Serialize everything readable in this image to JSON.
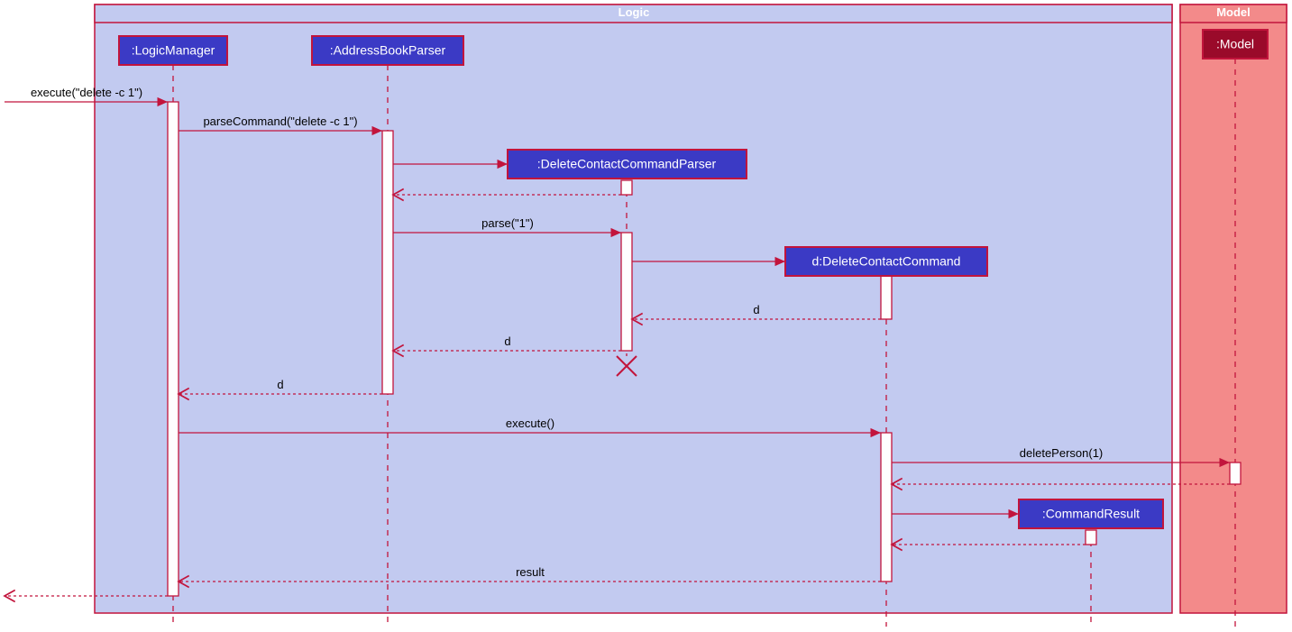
{
  "frames": {
    "logic": "Logic",
    "model": "Model"
  },
  "participants": {
    "logicManager": ":LogicManager",
    "addressBookParser": ":AddressBookParser",
    "deleteContactCommandParser": ":DeleteContactCommandParser",
    "deleteContactCommand": "d:DeleteContactCommand",
    "commandResult": ":CommandResult",
    "model": ":Model"
  },
  "messages": {
    "execute1": "execute(\"delete -c 1\")",
    "parseCommand": "parseCommand(\"delete -c 1\")",
    "parse": "parse(\"1\")",
    "d1": "d",
    "d2": "d",
    "d3": "d",
    "execute2": "execute()",
    "deletePerson": "deletePerson(1)",
    "result": "result"
  }
}
